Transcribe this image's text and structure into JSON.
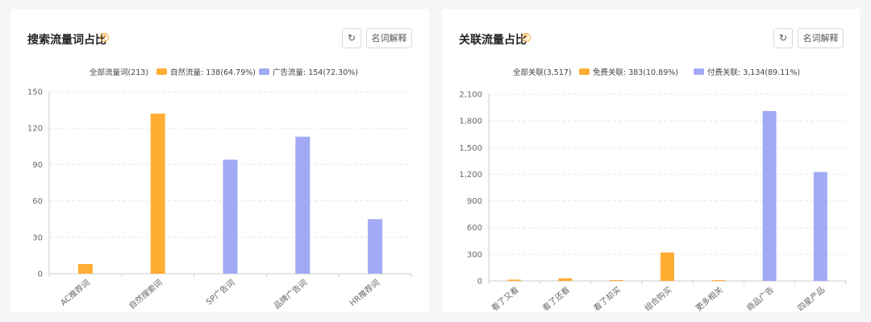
{
  "colors": {
    "natural": "#ffad33",
    "ad": "#a3aaf5",
    "grid": "#e8e8e8",
    "axis": "#cccccc",
    "tick": "#666666"
  },
  "panels": [
    {
      "title": "搜索流量词占比",
      "help_icon": "question-circle-icon",
      "refresh_icon": "refresh-icon",
      "glossary_label": "名词解释",
      "legend": {
        "all": "全部流量词(213)",
        "natural": "自然流量: 138(64.79%)",
        "ad": "广告流量: 154(72.30%)"
      }
    },
    {
      "title": "关联流量占比",
      "help_icon": "question-circle-icon",
      "refresh_icon": "refresh-icon",
      "glossary_label": "名词解释",
      "legend": {
        "all": "全部关联(3,517)",
        "natural": "免费关联: 383(10.89%)",
        "ad": "付费关联: 3,134(89.11%)"
      }
    }
  ],
  "chart_data": [
    {
      "type": "bar",
      "categories": [
        "AC推荐词",
        "自然搜索词",
        "SP广告词",
        "品牌广告词",
        "HR推荐词"
      ],
      "values": [
        8,
        132,
        94,
        113,
        45
      ],
      "bar_types": [
        "natural",
        "natural",
        "ad",
        "ad",
        "ad"
      ],
      "ylim": [
        0,
        150
      ],
      "yticks": [
        "0",
        "30",
        "60",
        "90",
        "120",
        "150"
      ],
      "grid": true
    },
    {
      "type": "bar",
      "categories": [
        "看了又看",
        "看了还看",
        "看了却买",
        "组合购买",
        "更多相关",
        "商品广告",
        "四星产品"
      ],
      "values": [
        15,
        30,
        3,
        320,
        3,
        1910,
        1225
      ],
      "bar_types": [
        "natural",
        "natural",
        "natural",
        "natural",
        "natural",
        "ad",
        "ad"
      ],
      "ylim": [
        0,
        2100
      ],
      "yticks": [
        "0",
        "300",
        "600",
        "900",
        "1,200",
        "1,500",
        "1,800",
        "2,100"
      ],
      "grid": true
    }
  ]
}
